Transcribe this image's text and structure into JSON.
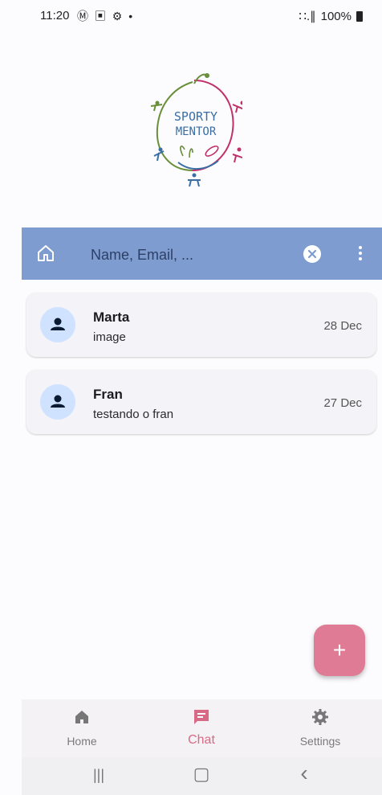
{
  "status_bar": {
    "time": "11:20",
    "left_icons": "Ⓜ ▣ ⚙ •",
    "signal_text": "∷.∥",
    "battery": "100%"
  },
  "logo": {
    "line1": "SPORTY",
    "line2": "MENTOR",
    "colors": [
      "#6a8f3a",
      "#c0306a",
      "#3a6ea5",
      "#e07b95"
    ]
  },
  "search": {
    "placeholder": "Name, Email, ..."
  },
  "chats": [
    {
      "name": "Marta",
      "preview": "image",
      "date": "28 Dec"
    },
    {
      "name": "Fran",
      "preview": "testando o fran",
      "date": "27 Dec"
    }
  ],
  "fab": {
    "label": "+"
  },
  "bottom_nav": {
    "items": [
      {
        "label": "Home",
        "icon": "home-icon",
        "active": false
      },
      {
        "label": "Chat",
        "icon": "chat-icon",
        "active": true
      },
      {
        "label": "Settings",
        "icon": "gear-icon",
        "active": false
      }
    ]
  },
  "system_nav": {
    "recents": "|||",
    "home": "▢",
    "back": "‹"
  },
  "colors": {
    "app_bar": "#7e9cd0",
    "accent": "#e07b95",
    "avatar_bg": "#cfe2ff",
    "card_bg": "#f3f3f8"
  }
}
